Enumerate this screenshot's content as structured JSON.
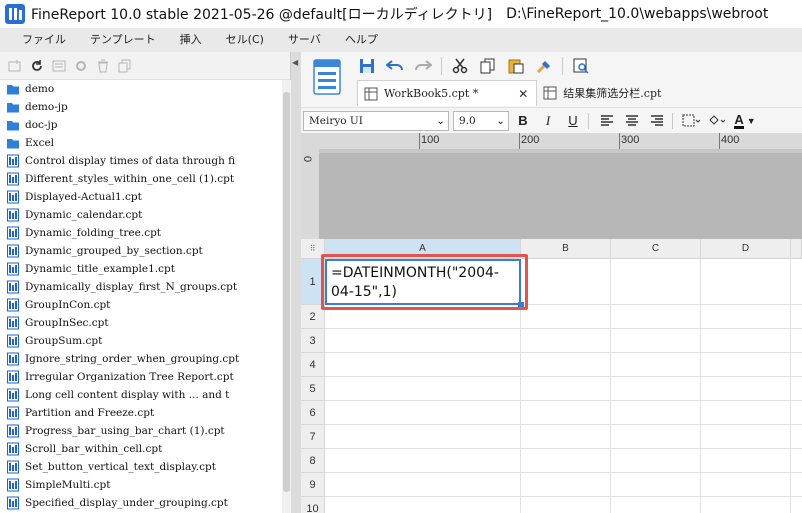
{
  "window": {
    "title": "FineReport 10.0 stable 2021-05-26 @default[ローカルディレクトリ]",
    "path": "D:\\FineReport_10.0\\webapps\\webroot"
  },
  "menu": [
    "ファイル",
    "テンプレート",
    "挿入",
    "セル(C)",
    "サーバ",
    "ヘルプ"
  ],
  "file_tree": {
    "folders": [
      "demo",
      "demo-jp",
      "doc-jp",
      "Excel"
    ],
    "files": [
      "Control display times of data through fi",
      "Different_styles_within_one_cell (1).cpt",
      "Displayed-Actual1.cpt",
      "Dynamic_calendar.cpt",
      "Dynamic_folding_tree.cpt",
      "Dynamic_grouped_by_section.cpt",
      "Dynamic_title_example1.cpt",
      "Dynamically_display_first_N_groups.cpt",
      "GroupInCon.cpt",
      "GroupInSec.cpt",
      "GroupSum.cpt",
      "Ignore_string_order_when_grouping.cpt",
      "Irregular Organization Tree Report.cpt",
      "Long cell content display with ... and t",
      "Partition and Freeze.cpt",
      "Progress_bar_using_bar_chart (1).cpt",
      "Scroll_bar_within_cell.cpt",
      "Set_button_vertical_text_display.cpt",
      "SimpleMulti.cpt",
      "Specified_display_under_grouping.cpt"
    ]
  },
  "tabs": [
    {
      "label": "WorkBook5.cpt *",
      "active": true
    },
    {
      "label": "结果集筛选分栏.cpt",
      "active": false
    }
  ],
  "format": {
    "font": "Meiryo UI",
    "size": "9.0",
    "bold": "B",
    "italic": "I",
    "underline": "U",
    "font_color": "A"
  },
  "ruler": {
    "labels": [
      "0",
      "100",
      "200",
      "300",
      "400"
    ]
  },
  "grid": {
    "columns": [
      "A",
      "B",
      "C",
      "D"
    ],
    "rows": [
      "1",
      "2",
      "3",
      "4",
      "5",
      "6",
      "7",
      "8",
      "9",
      "10"
    ],
    "corner": "⠿",
    "cell_a1": "=DATEINMONTH(\"2004-04-15\",1)"
  },
  "colors": {
    "selection_border": "#3a7bd5",
    "highlight_box": "#e0554f",
    "header_selected": "#cde3f4",
    "file_icon": "#1e63c6",
    "folder_icon": "#2f7fd8"
  }
}
